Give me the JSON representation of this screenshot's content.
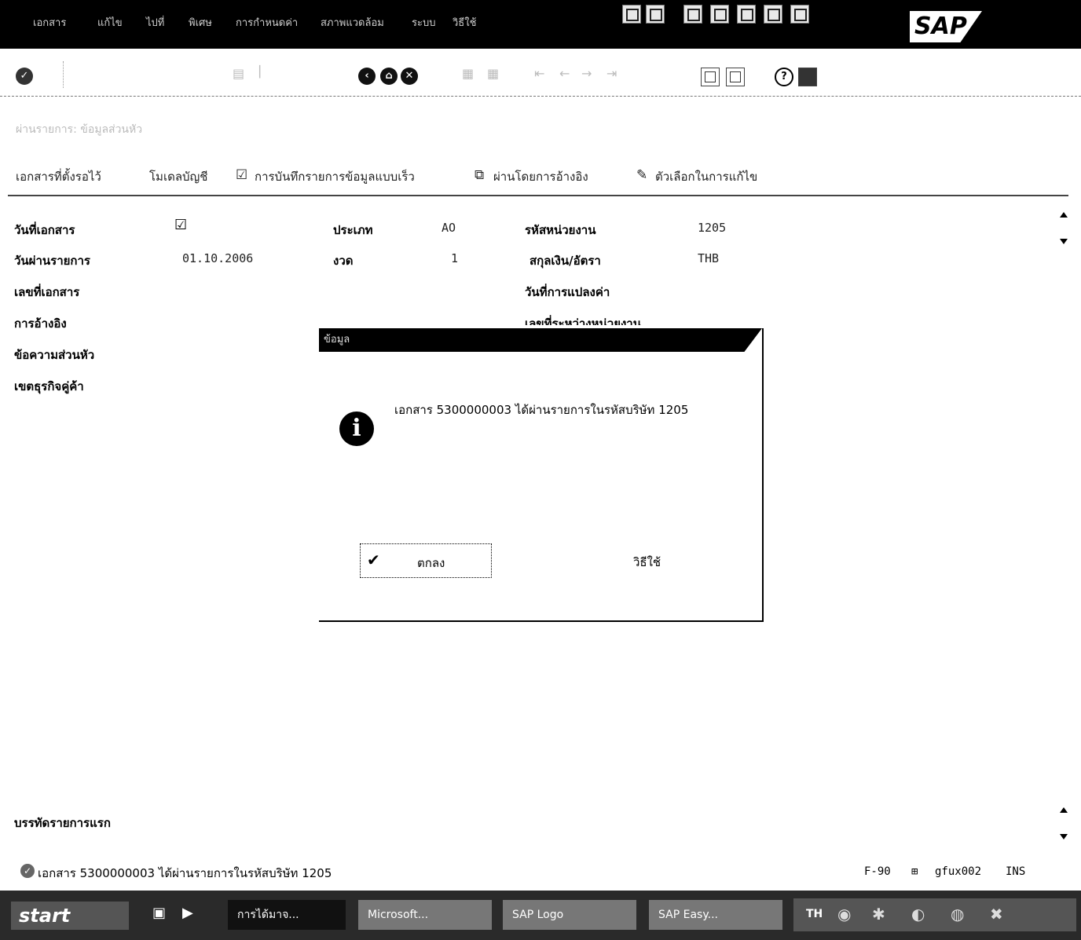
{
  "menu": {
    "items": [
      "เอกสาร",
      "แก้ไข",
      "ไปที่",
      "พิเศษ",
      "การกำหนดค่า",
      "สภาพแวดล้อม",
      "ระบบ",
      "วิธีใช้"
    ],
    "brand": "SAP"
  },
  "screen": {
    "title": "ผ่านรายการ: ข้อมูลส่วนหัว"
  },
  "app_toolbar": {
    "held_docs": "เอกสารที่ตั้งรอไว้",
    "acct_model": "โมเดลบัญชี",
    "fast_entry": "การบันทึกรายการข้อมูลแบบเร็ว",
    "post_ref": "ผ่านโดยการอ้างอิง",
    "edit_options": "ตัวเลือกในการแก้ไข"
  },
  "header": {
    "doc_date_label": "วันที่เอกสาร",
    "posting_date_label": "วันผ่านรายการ",
    "posting_date_value": "01.10.2006",
    "doc_number_label": "เลขที่เอกสาร",
    "reference_label": "การอ้างอิง",
    "header_text_label": "ข้อความส่วนหัว",
    "partner_area_label": "เขตธุรกิจคู่ค้า",
    "type_label": "ประเภท",
    "type_value": "AO",
    "period_label": "งวด",
    "period_value": "1",
    "company_code_label": "รหัสหน่วยงาน",
    "company_code_value": "1205",
    "currency_label": "สกุลเงิน/อัตรา",
    "currency_value": "THB",
    "translation_date_label": "วันที่การแปลงค่า",
    "cross_cc_label": "เลขที่ระหว่างหน่วยงาน"
  },
  "first_line": {
    "label": "บรรทัดรายการแรก"
  },
  "dialog": {
    "title": "ข้อมูล",
    "message": "เอกสาร 5300000003 ได้ผ่านรายการในรหัสบริษัท 1205",
    "ok_label": "ตกลง",
    "help_label": "วิธีใช้"
  },
  "status": {
    "message": "เอกสาร 5300000003 ได้ผ่านรายการในรหัสบริษัท 1205",
    "transaction": "F-90",
    "user": "gfux002",
    "mode": "INS"
  },
  "taskbar": {
    "start": "start",
    "tasks": [
      "การได้มาจ...",
      "Microsoft...",
      "SAP Logo",
      "SAP Easy..."
    ],
    "lang": "TH"
  }
}
